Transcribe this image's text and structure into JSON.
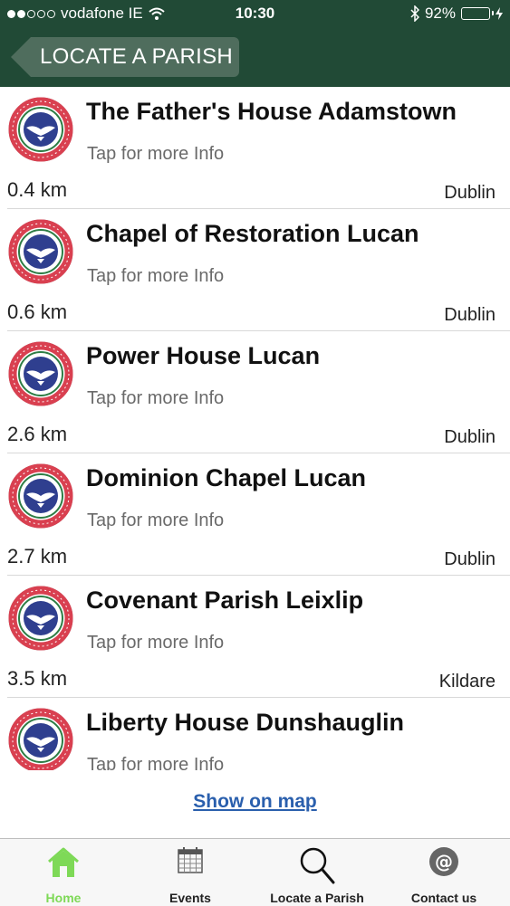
{
  "status_bar": {
    "carrier": "vodafone IE",
    "signal_filled": 2,
    "signal_total": 5,
    "time": "10:30",
    "battery_percent": "92%",
    "battery_level": 0.92,
    "icons": [
      "wifi-icon",
      "bluetooth-icon",
      "battery-icon",
      "charging-icon"
    ]
  },
  "header": {
    "back_label": "LOCATE A PARISH"
  },
  "parishes": [
    {
      "name": "The Father's House Adamstown",
      "subtitle": "Tap for more Info",
      "distance": "0.4  km",
      "county": "Dublin"
    },
    {
      "name": "Chapel of Restoration Lucan",
      "subtitle": "Tap for more Info",
      "distance": "0.6  km",
      "county": "Dublin"
    },
    {
      "name": "Power House Lucan",
      "subtitle": "Tap for more Info",
      "distance": "2.6  km",
      "county": "Dublin"
    },
    {
      "name": "Dominion Chapel Lucan",
      "subtitle": "Tap for more Info",
      "distance": "2.7  km",
      "county": "Dublin"
    },
    {
      "name": "Covenant Parish Leixlip",
      "subtitle": "Tap for more Info",
      "distance": "3.5  km",
      "county": "Kildare"
    },
    {
      "name": "Liberty House Dunshauglin",
      "subtitle": "Tap for more Info",
      "distance": "",
      "county": ""
    }
  ],
  "logo": {
    "icon": "rccg-logo-icon",
    "ring_text": "THE REDEEMED CHRISTIAN CHURCH OF GOD",
    "ring_color": "#d94050",
    "dove_bg": "#2f3f8f"
  },
  "show_map_label": "Show on map",
  "tabs": [
    {
      "label": "Home",
      "icon": "home-icon",
      "active": true
    },
    {
      "label": "Events",
      "icon": "calendar-icon",
      "active": false
    },
    {
      "label": "Locate a Parish",
      "icon": "search-icon",
      "active": false
    },
    {
      "label": "Contact us",
      "icon": "at-sign-icon",
      "active": false
    }
  ],
  "colors": {
    "header_bg": "#214a36",
    "back_button": "#4f6d5d",
    "link": "#2a5fad",
    "active_tab": "#7ed957"
  }
}
